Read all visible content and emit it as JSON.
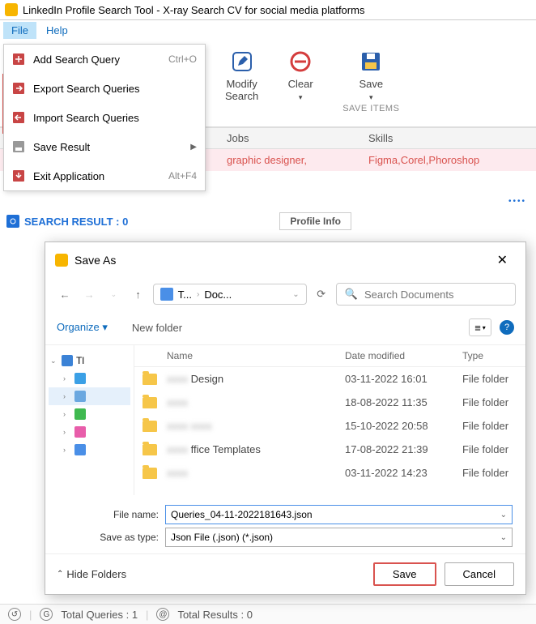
{
  "title": "LinkedIn Profile Search Tool - X-ray Search CV for social media platforms",
  "menu": {
    "file": "File",
    "help": "Help"
  },
  "dropdown": [
    {
      "label": "Add Search Query",
      "shortcut": "Ctrl+O"
    },
    {
      "label": "Export Search Queries"
    },
    {
      "label": "Import Search Queries"
    },
    {
      "label": "Save Result",
      "submenu": true
    },
    {
      "label": "Exit Application",
      "shortcut": "Alt+F4"
    }
  ],
  "ribbon": {
    "modify": "Modify\nSearch",
    "clear": "Clear",
    "save": "Save",
    "group": "SAVE ITEMS"
  },
  "grid": {
    "headers": {
      "jobs": "Jobs",
      "skills": "Skills"
    },
    "row": {
      "jobs": "graphic designer,",
      "skills": "Figma,Corel,Phoroshop"
    }
  },
  "search_result": "SEARCH RESULT : 0",
  "profile_tab": "Profile Info",
  "dialog": {
    "title": "Save As",
    "back": "←",
    "fwd": "→",
    "up": "↑",
    "refresh": "⟳",
    "bc1": "T...",
    "bc2": "Doc...",
    "search_ph": "Search Documents",
    "organize": "Organize",
    "newfolder": "New folder",
    "cols": {
      "name": "Name",
      "date": "Date modified",
      "type": "Type"
    },
    "tree_root": "Tl",
    "rows": [
      {
        "name": "█████ Design",
        "date": "03-11-2022 16:01",
        "type": "File folder"
      },
      {
        "name": "███",
        "date": "18-08-2022 11:35",
        "type": "File folder"
      },
      {
        "name": "████ ███",
        "date": "15-10-2022 20:58",
        "type": "File folder"
      },
      {
        "name": "█████ ffice Templates",
        "date": "17-08-2022 21:39",
        "type": "File folder"
      },
      {
        "name": "████████",
        "date": "03-11-2022 14:23",
        "type": "File folder"
      }
    ],
    "filename_label": "File name:",
    "filename": "Queries_04-11-2022181643.json",
    "type_label": "Save as type:",
    "type_val": "Json File (.json) (*.json)",
    "hide": "Hide Folders",
    "save": "Save",
    "cancel": "Cancel"
  },
  "status": {
    "tq": "Total Queries : 1",
    "tr": "Total Results : 0"
  }
}
